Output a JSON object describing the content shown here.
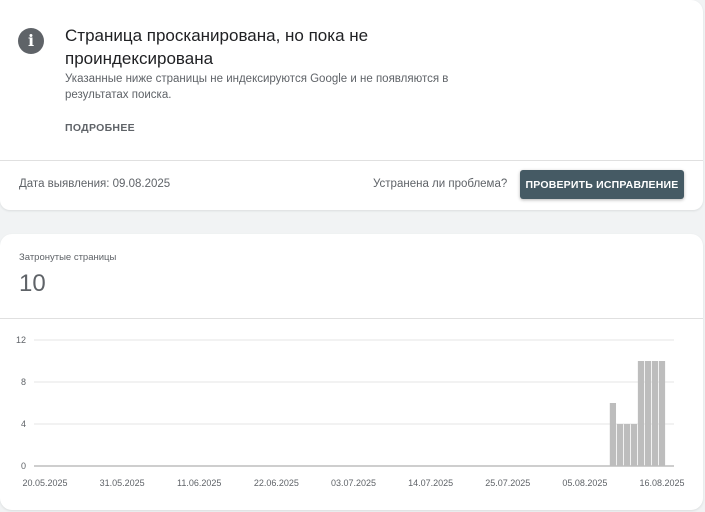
{
  "issue": {
    "icon": "info-icon",
    "title": "Страница просканирована, но пока не проиндексирована",
    "description": "Указанные ниже страницы не индексируются Google и не появляются в результатах поиска.",
    "more_link": "ПОДРОБНЕЕ",
    "detected_label": "Дата выявления: 09.08.2025",
    "resolved_question": "Устранена ли проблема?",
    "validate_button": "ПРОВЕРИТЬ ИСПРАВЛЕНИЕ"
  },
  "affected": {
    "label": "Затронутые страницы",
    "count": "10"
  },
  "chart_data": {
    "type": "bar",
    "ylim": [
      0,
      12
    ],
    "y_ticks": [
      "0",
      "4",
      "8",
      "12"
    ],
    "x_tick_labels": [
      "20.05.2025",
      "31.05.2025",
      "11.06.2025",
      "22.06.2025",
      "03.07.2025",
      "14.07.2025",
      "25.07.2025",
      "05.08.2025",
      "16.08.2025"
    ],
    "x_start": "20.05.2025",
    "x_end": "16.08.2025",
    "bar_color": "#bdbdbd",
    "bars": [
      {
        "date": "09.08.2025",
        "value": 6
      },
      {
        "date": "10.08.2025",
        "value": 4
      },
      {
        "date": "11.08.2025",
        "value": 4
      },
      {
        "date": "12.08.2025",
        "value": 4
      },
      {
        "date": "13.08.2025",
        "value": 10
      },
      {
        "date": "14.08.2025",
        "value": 10
      },
      {
        "date": "15.08.2025",
        "value": 10
      },
      {
        "date": "16.08.2025",
        "value": 10
      }
    ]
  }
}
